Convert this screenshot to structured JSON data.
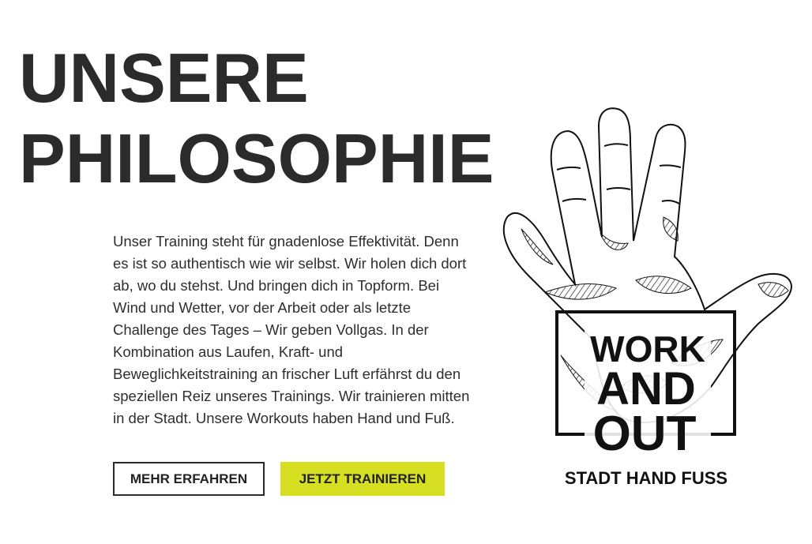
{
  "heading": {
    "line1": "UNSERE",
    "line2": "PHILOSOPHIE"
  },
  "intro": {
    "text": "Unser Training steht für gnadenlose Effektivität. Denn es ist so authentisch wie wir selbst. Wir holen dich dort ab, wo du stehst. Und bringen dich in Topform. Bei Wind und Wetter, vor der Arbeit oder als letzte Challenge des Tages – Wir geben Vollgas. In der Kombination aus Laufen, Kraft- und Beweglichkeitstraining an frischer Luft erfährst du den speziellen Reiz unseres Trainings. Wir trainieren mitten in der Stadt. Unsere Workouts haben Hand und Fuß."
  },
  "buttons": {
    "more_label": "MEHR ERFAHREN",
    "train_label": "JETZT TRAINIEREN"
  },
  "logo": {
    "line1": "WORK",
    "line2": "AND",
    "line3": "OUT",
    "tagline": "STADT HAND FUSS",
    "icon": "hand-drawing-icon"
  },
  "colors": {
    "accent": "#d7df23",
    "text": "#2b2b2b"
  }
}
